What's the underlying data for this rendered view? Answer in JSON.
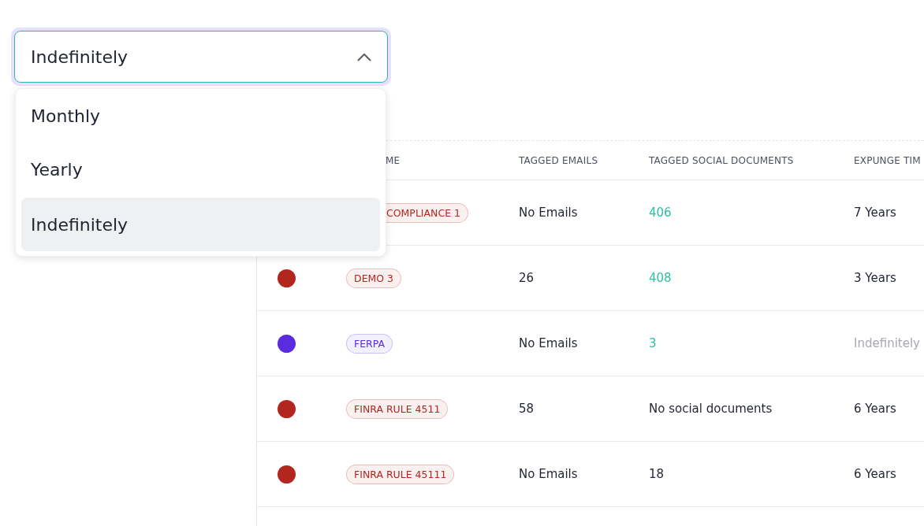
{
  "select": {
    "value": "Indefinitely",
    "expanded": true,
    "options": [
      {
        "label": "Monthly",
        "selected": false
      },
      {
        "label": "Yearly",
        "selected": false
      },
      {
        "label": "Indefinitely",
        "selected": true
      }
    ]
  },
  "table": {
    "columns": [
      "ME",
      "TAGGED EMAILS",
      "TAGGED SOCIAL DOCUMENTS",
      "EXPUNGE TIM"
    ],
    "rows": [
      {
        "tag": "COMPLIANCE 1",
        "emails": "No Emails",
        "social": {
          "text": "406",
          "linked": true
        },
        "expunge": {
          "text": "7 Years",
          "muted": false
        }
      },
      {
        "color": "#b3261e",
        "tag": "DEMO 3",
        "emails": "26",
        "social": {
          "text": "408",
          "linked": true
        },
        "expunge": {
          "text": "3 Years",
          "muted": false
        }
      },
      {
        "color": "#5b2be0",
        "tag": "FERPA",
        "emails": "No Emails",
        "social": {
          "text": "3",
          "linked": true
        },
        "expunge": {
          "text": "Indefinitely",
          "muted": true
        }
      },
      {
        "color": "#b3261e",
        "tag": "FINRA RULE 4511",
        "emails": "58",
        "social": {
          "text": "No social documents",
          "linked": false
        },
        "expunge": {
          "text": "6 Years",
          "muted": false
        }
      },
      {
        "color": "#b3261e",
        "tag": "FINRA RULE 45111",
        "emails": "No Emails",
        "social": {
          "text": "18",
          "linked": false
        },
        "expunge": {
          "text": "6 Years",
          "muted": false
        }
      }
    ]
  }
}
